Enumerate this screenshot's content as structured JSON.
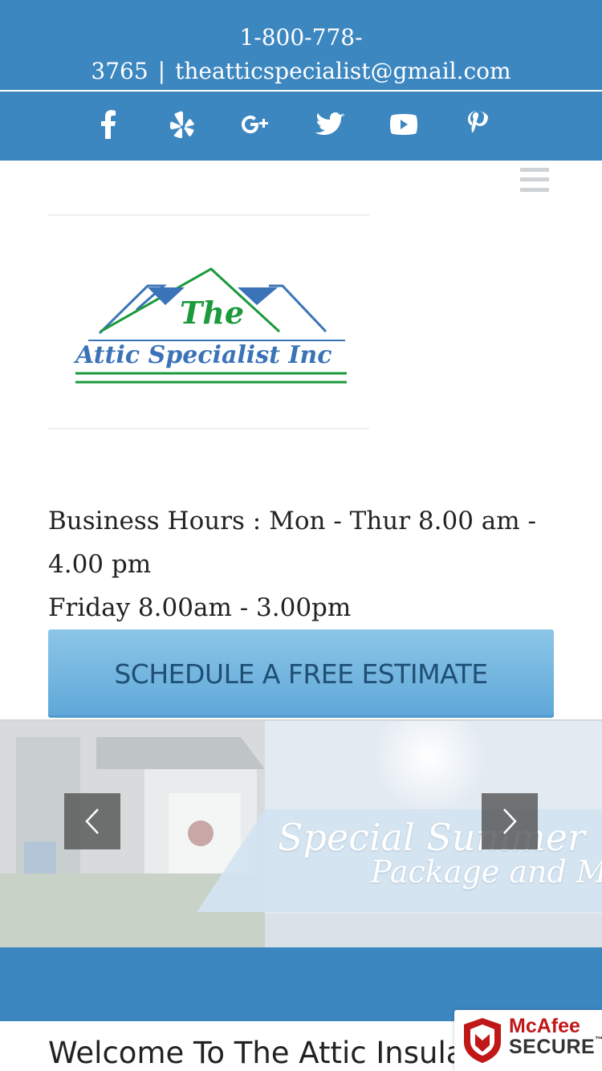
{
  "topbar": {
    "phone_line1": "1-800-778-",
    "phone_line2": "3765",
    "separator": "|",
    "email": "theatticspecialist@gmail.com",
    "background_color": "#3d87c1",
    "social_icons": [
      "facebook-icon",
      "yelp-icon",
      "google-plus-icon",
      "twitter-icon",
      "youtube-icon",
      "pinterest-icon"
    ]
  },
  "header": {
    "menu_icon": "hamburger-menu-icon",
    "logo": {
      "word_the": "The",
      "company": "Attic Specialist Inc"
    }
  },
  "hours": {
    "line1": "Business Hours : Mon - Thur 8.00 am -",
    "line2": "4.00 pm",
    "line3": "Friday 8.00am - 3.00pm"
  },
  "cta": {
    "label": "SCHEDULE A FREE ESTIMATE"
  },
  "slider": {
    "title": "Special Summer",
    "subtitle": "Package and More",
    "prev_icon": "chevron-left-icon",
    "next_icon": "chevron-right-icon"
  },
  "main": {
    "heading": "Welcome To The Attic Insulation"
  },
  "badge": {
    "brand": "McAfee",
    "tm": "™",
    "secure": "SECURE"
  }
}
